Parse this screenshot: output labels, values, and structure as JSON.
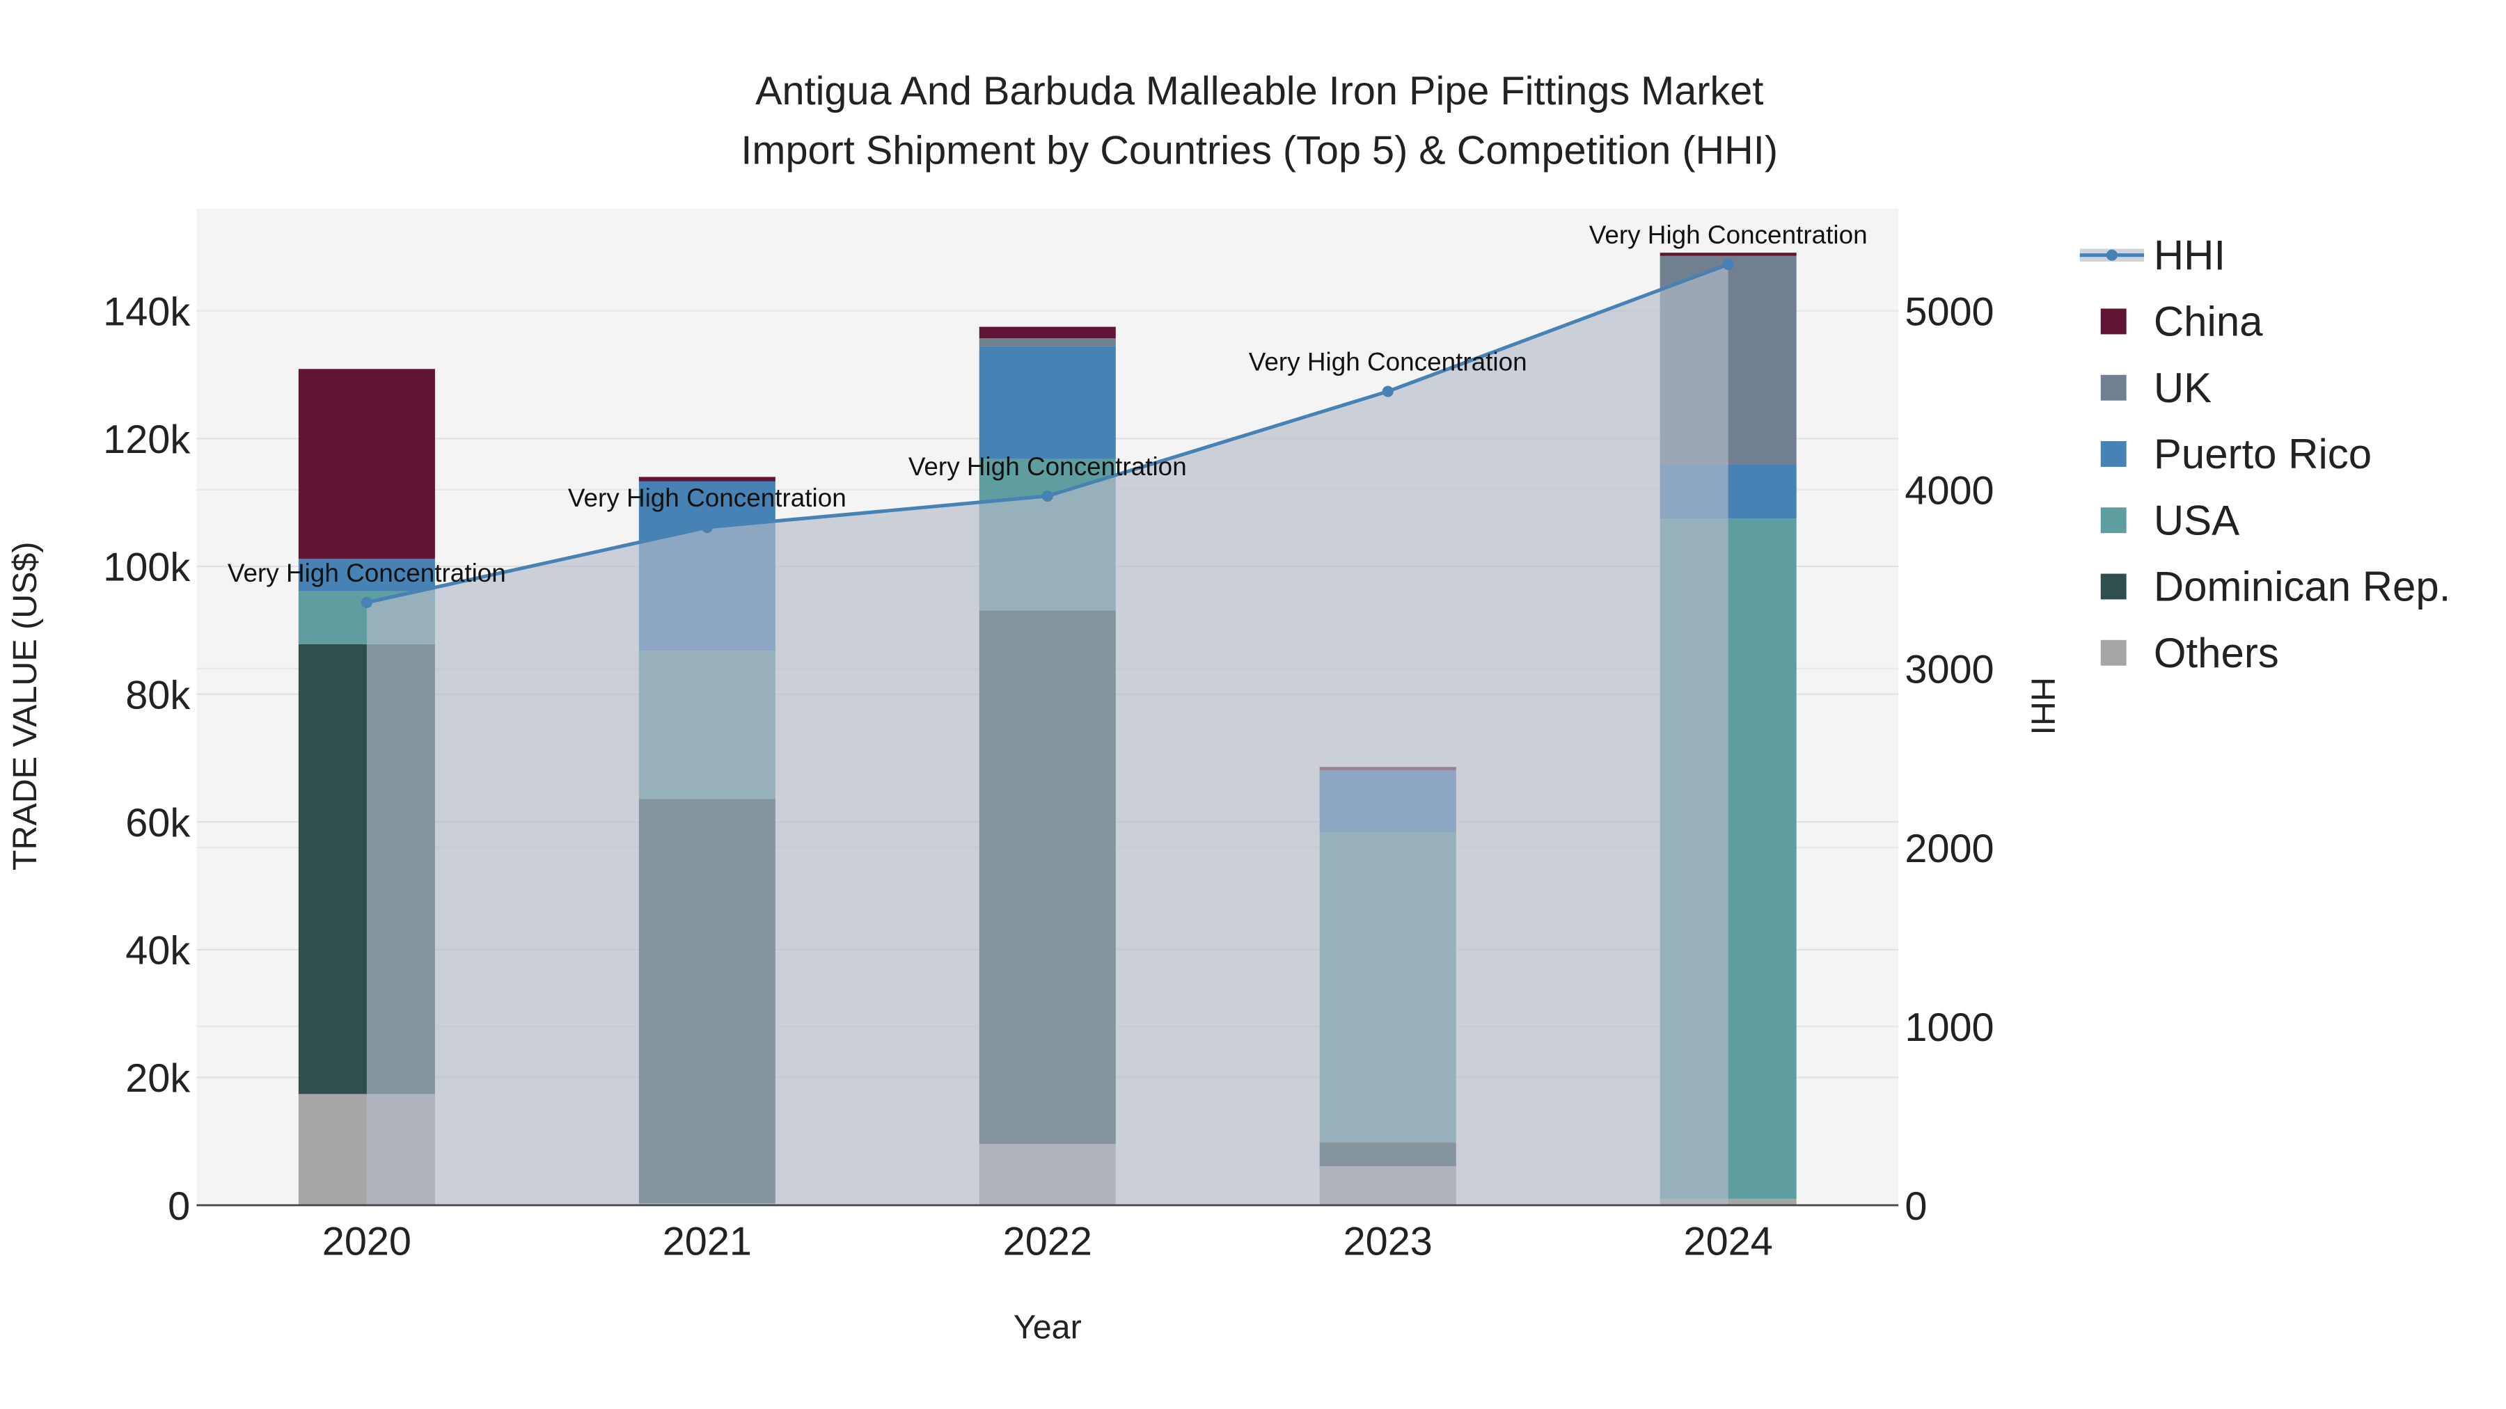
{
  "chart_data": {
    "type": "bar",
    "stacked": true,
    "title_line1": "Antigua And Barbuda Malleable Iron Pipe Fittings Market",
    "title_line2": "Import Shipment by Countries (Top 5) & Competition (HHI)",
    "xlabel": "Year",
    "ylabel": "TRADE VALUE (US$)",
    "y2label": "HHI",
    "categories": [
      "2020",
      "2021",
      "2022",
      "2023",
      "2024"
    ],
    "ylim": [
      0,
      156000
    ],
    "y2lim": [
      0,
      5572
    ],
    "yticks": [
      0,
      20000,
      40000,
      60000,
      80000,
      100000,
      120000,
      140000
    ],
    "ytick_labels": [
      "0",
      "20k",
      "40k",
      "60k",
      "80k",
      "100k",
      "120k",
      "140k"
    ],
    "y2ticks": [
      0,
      1000,
      2000,
      3000,
      4000,
      5000
    ],
    "y2tick_labels": [
      "0",
      "1000",
      "2000",
      "3000",
      "4000",
      "5000"
    ],
    "series": [
      {
        "name": "Others",
        "color": "#a6a6a6",
        "values": [
          17400,
          300,
          9600,
          6100,
          1000
        ]
      },
      {
        "name": "Dominican Rep.",
        "color": "#2f4f4f",
        "values": [
          70400,
          63300,
          83500,
          3700,
          0
        ]
      },
      {
        "name": "USA",
        "color": "#5f9ea0",
        "values": [
          8300,
          23200,
          23700,
          48500,
          106500
        ]
      },
      {
        "name": "Puerto Rico",
        "color": "#4682b4",
        "values": [
          5100,
          26500,
          17700,
          9800,
          8500
        ]
      },
      {
        "name": "UK",
        "color": "#708090",
        "values": [
          0,
          0,
          1200,
          0,
          32600
        ]
      },
      {
        "name": "China",
        "color": "#611434",
        "values": [
          29700,
          700,
          1800,
          500,
          500
        ]
      }
    ],
    "hhi": {
      "name": "HHI",
      "color": "#4682b4",
      "values": [
        3370,
        3790,
        3965,
        4550,
        5260
      ],
      "annotations": [
        "Very High Concentration",
        "Very High Concentration",
        "Very High Concentration",
        "Very High Concentration",
        "Very High Concentration"
      ]
    },
    "legend": {
      "placement": "right",
      "entries": [
        "HHI",
        "China",
        "UK",
        "Puerto Rico",
        "USA",
        "Dominican Rep.",
        "Others"
      ]
    },
    "grid": true
  }
}
